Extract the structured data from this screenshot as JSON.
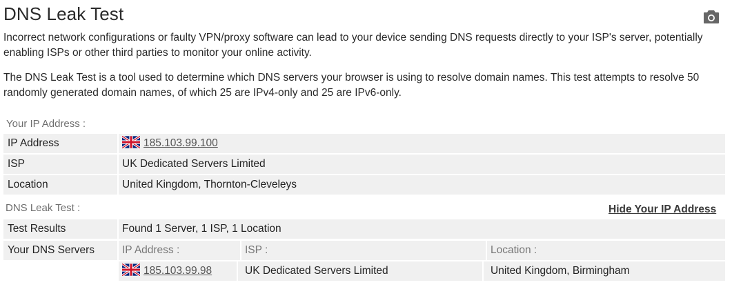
{
  "title": "DNS Leak Test",
  "camera_icon": "camera-icon",
  "intro": {
    "paragraph1": "Incorrect network configurations or faulty VPN/proxy software can lead to your device sending DNS requests directly to your ISP's server, potentially enabling ISPs or other third parties to monitor your online activity.",
    "paragraph2": "The DNS Leak Test is a tool used to determine which DNS servers your browser is using to resolve domain names. This test attempts to resolve 50 randomly generated domain names, of which 25 are IPv4-only and 25 are IPv6-only."
  },
  "ip_section": {
    "label": "Your IP Address :",
    "rows": [
      {
        "key": "IP Address",
        "value": "185.103.99.100",
        "flag": "uk-flag-icon"
      },
      {
        "key": "ISP",
        "value": "UK Dedicated Servers Limited"
      },
      {
        "key": "Location",
        "value": "United Kingdom, Thornton-Cleveleys"
      }
    ]
  },
  "dns_section": {
    "label": "DNS Leak Test :",
    "hide_ip_label": "Hide Your IP Address",
    "results_key": "Test Results",
    "results_value": "Found 1 Server, 1 ISP, 1 Location",
    "servers_key": "Your DNS Servers",
    "columns": [
      "IP Address :",
      "ISP :",
      "Location :"
    ],
    "servers": [
      {
        "ip": "185.103.99.98",
        "isp": "UK Dedicated Servers Limited",
        "location": "United Kingdom, Birmingham",
        "flag": "uk-flag-icon"
      }
    ]
  }
}
